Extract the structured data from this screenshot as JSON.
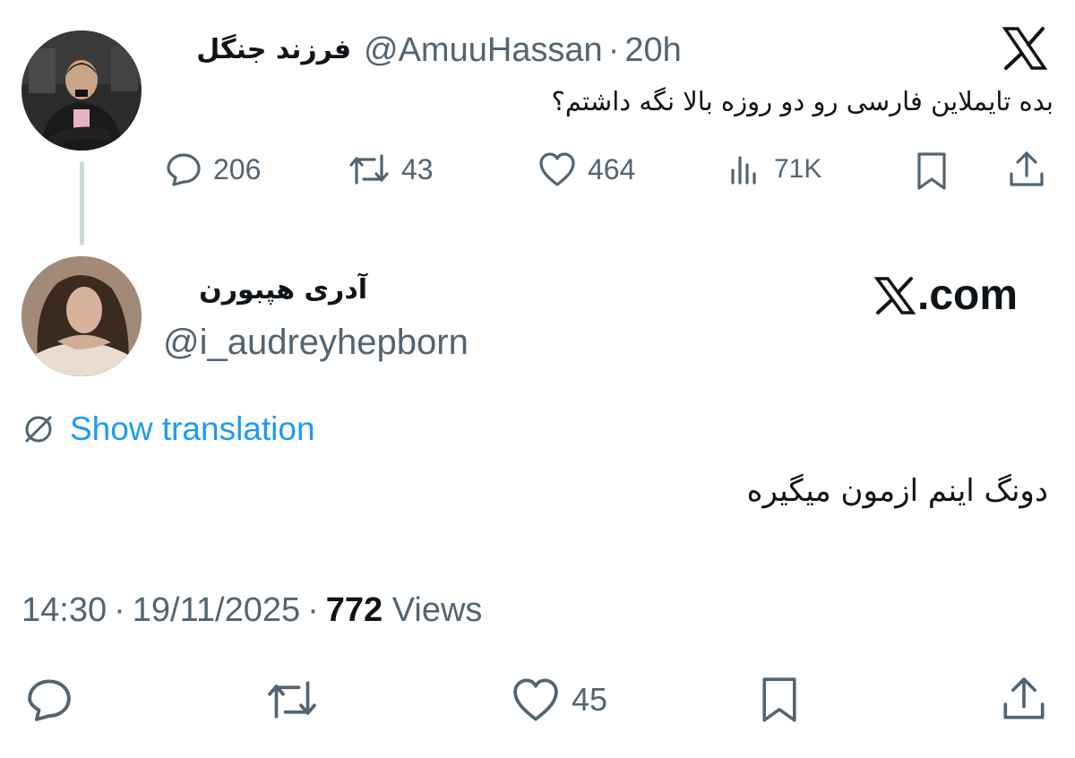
{
  "parent_tweet": {
    "display_name": "فرزند جنگل",
    "handle": "@AmuuHassan",
    "separator": "·",
    "time": "20h",
    "text": "بده تایملاین فارسی رو دو روزه بالا نگه داشتم؟",
    "stats": {
      "replies": "206",
      "retweets": "43",
      "likes": "464",
      "views": "71K"
    }
  },
  "reply_tweet": {
    "display_name": "آدری هپبورن",
    "handle": "@i_audreyhepborn",
    "brand": ".com",
    "show_translation": "Show translation",
    "text": "دونگ اینم ازمون میگیره",
    "time": "14:30",
    "separator": "·",
    "date": "19/11/2025",
    "views_count": "772",
    "views_label": "Views",
    "stats": {
      "likes": "45"
    }
  },
  "icons": {
    "x_logo": "x-logo-icon",
    "reply": "reply-bubble-icon",
    "retweet": "retweet-icon",
    "like": "heart-icon",
    "views": "bar-chart-icon",
    "bookmark": "bookmark-icon",
    "share": "share-upload-icon",
    "translate": "translate-slash-icon"
  },
  "colors": {
    "text_primary": "#0f1419",
    "text_secondary": "#536471",
    "link": "#1d9bf0",
    "thread_line": "#cfd9de"
  }
}
